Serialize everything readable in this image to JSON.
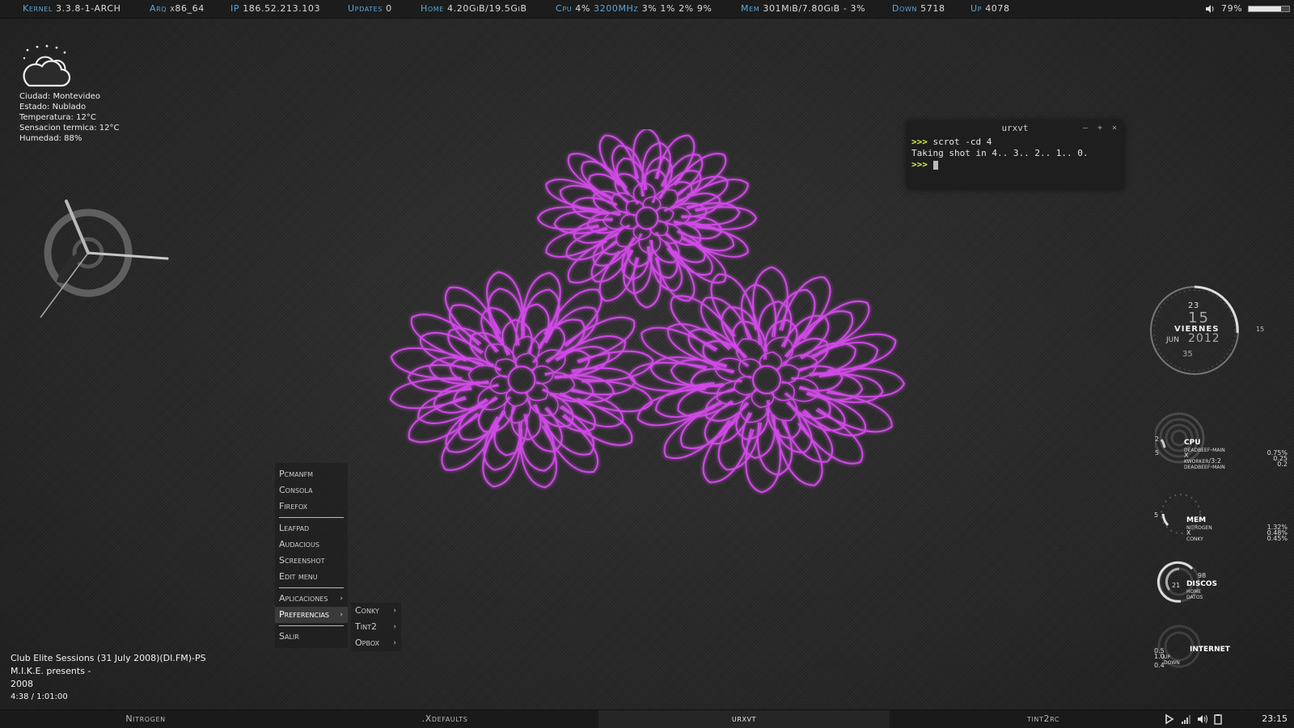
{
  "topbar": {
    "kernel_label": "Kernel",
    "kernel_value": "3.3.8-1-ARCH",
    "arq_label": "Arq",
    "arq_value": "x86_64",
    "ip_label": "IP",
    "ip_value": "186.52.213.103",
    "updates_label": "Updates",
    "updates_value": "0",
    "home_label": "Home",
    "home_value": "4.20GiB/19.5GiB",
    "cpu_label": "Cpu",
    "cpu_value": "4%",
    "cpu_freq": "3200MHz",
    "cpu_cores": "3% 1% 2% 9%",
    "mem_label": "Mem",
    "mem_value": "301MiB/7.80GiB - 3%",
    "down_label": "Down",
    "down_value": "5718",
    "up_label": "Up",
    "up_value": "4078",
    "volume_icon": "speaker-icon",
    "volume_value": "79%",
    "volume_level": 0.79
  },
  "weather": {
    "icon": "cloudy-night-icon",
    "lines": [
      "Ciudad: Montevideo",
      "Estado: Nublado",
      "Temperatura: 12°C",
      "Sensacion termica: 12°C",
      "Humedad: 88%"
    ]
  },
  "terminal": {
    "title": "urxvt",
    "controls": [
      "–",
      "+",
      "×"
    ],
    "prompt": ">>>",
    "line1_cmd": "scrot -cd 4",
    "line2_out": "Taking shot in 4.. 3.. 2.. 1.. 0."
  },
  "date_widget": {
    "hour": "23",
    "minute": "15",
    "second": "35",
    "day_name": "VIERNES",
    "month": "JUN",
    "year": "2012",
    "right_mark": "15"
  },
  "gauges": {
    "cpu": {
      "title": "CPU",
      "procs": [
        "deadbeef-main",
        "X",
        "kworker/3:2",
        "deadbeef-main"
      ],
      "values": [
        "0.75%",
        "0.25",
        "0.2"
      ],
      "marks": [
        "2",
        "5"
      ]
    },
    "mem": {
      "title": "MEM",
      "procs": [
        "nitrogen",
        "X",
        "conky"
      ],
      "values": [
        "1.32%",
        "0.48%",
        "0.45%"
      ],
      "marks": [
        "5"
      ]
    },
    "discos": {
      "title": "DISCOS",
      "procs": [
        "home",
        "datos"
      ],
      "marks": [
        "98",
        "21"
      ]
    },
    "internet": {
      "title": "INTERNET",
      "procs": [
        "up",
        "down"
      ],
      "marks": [
        "0.5",
        "1.0",
        "0.4"
      ]
    }
  },
  "menu": {
    "items": [
      "Pcmanfm",
      "Consola",
      "Firefox",
      "Leafpad",
      "Audacious",
      "Screenshot",
      "Edit menu",
      "Aplicaciones",
      "Preferencias",
      "Salir"
    ],
    "submenu": [
      "Conky",
      "Tint2",
      "Opbox"
    ],
    "arrow": "›"
  },
  "nowplaying": {
    "line1": "Club Elite Sessions (31 July 2008)(DI.FM)-PS",
    "line2": "M.I.K.E. presents -",
    "line3": "2008",
    "time": "4:38 / 1:01:00"
  },
  "taskbar": {
    "tasks": [
      "Nitrogen",
      ".Xdefaults",
      "urxvt",
      "tint2rc"
    ],
    "active_index": 2,
    "clock": "23:15",
    "tray_icons": [
      "play-icon",
      "signal-icon",
      "volume-icon",
      "clipboard-icon"
    ]
  },
  "colors": {
    "label_blue": "#5ea6d6",
    "flower_magenta": "#d04ae6",
    "prompt_yellow": "#d7f542"
  }
}
